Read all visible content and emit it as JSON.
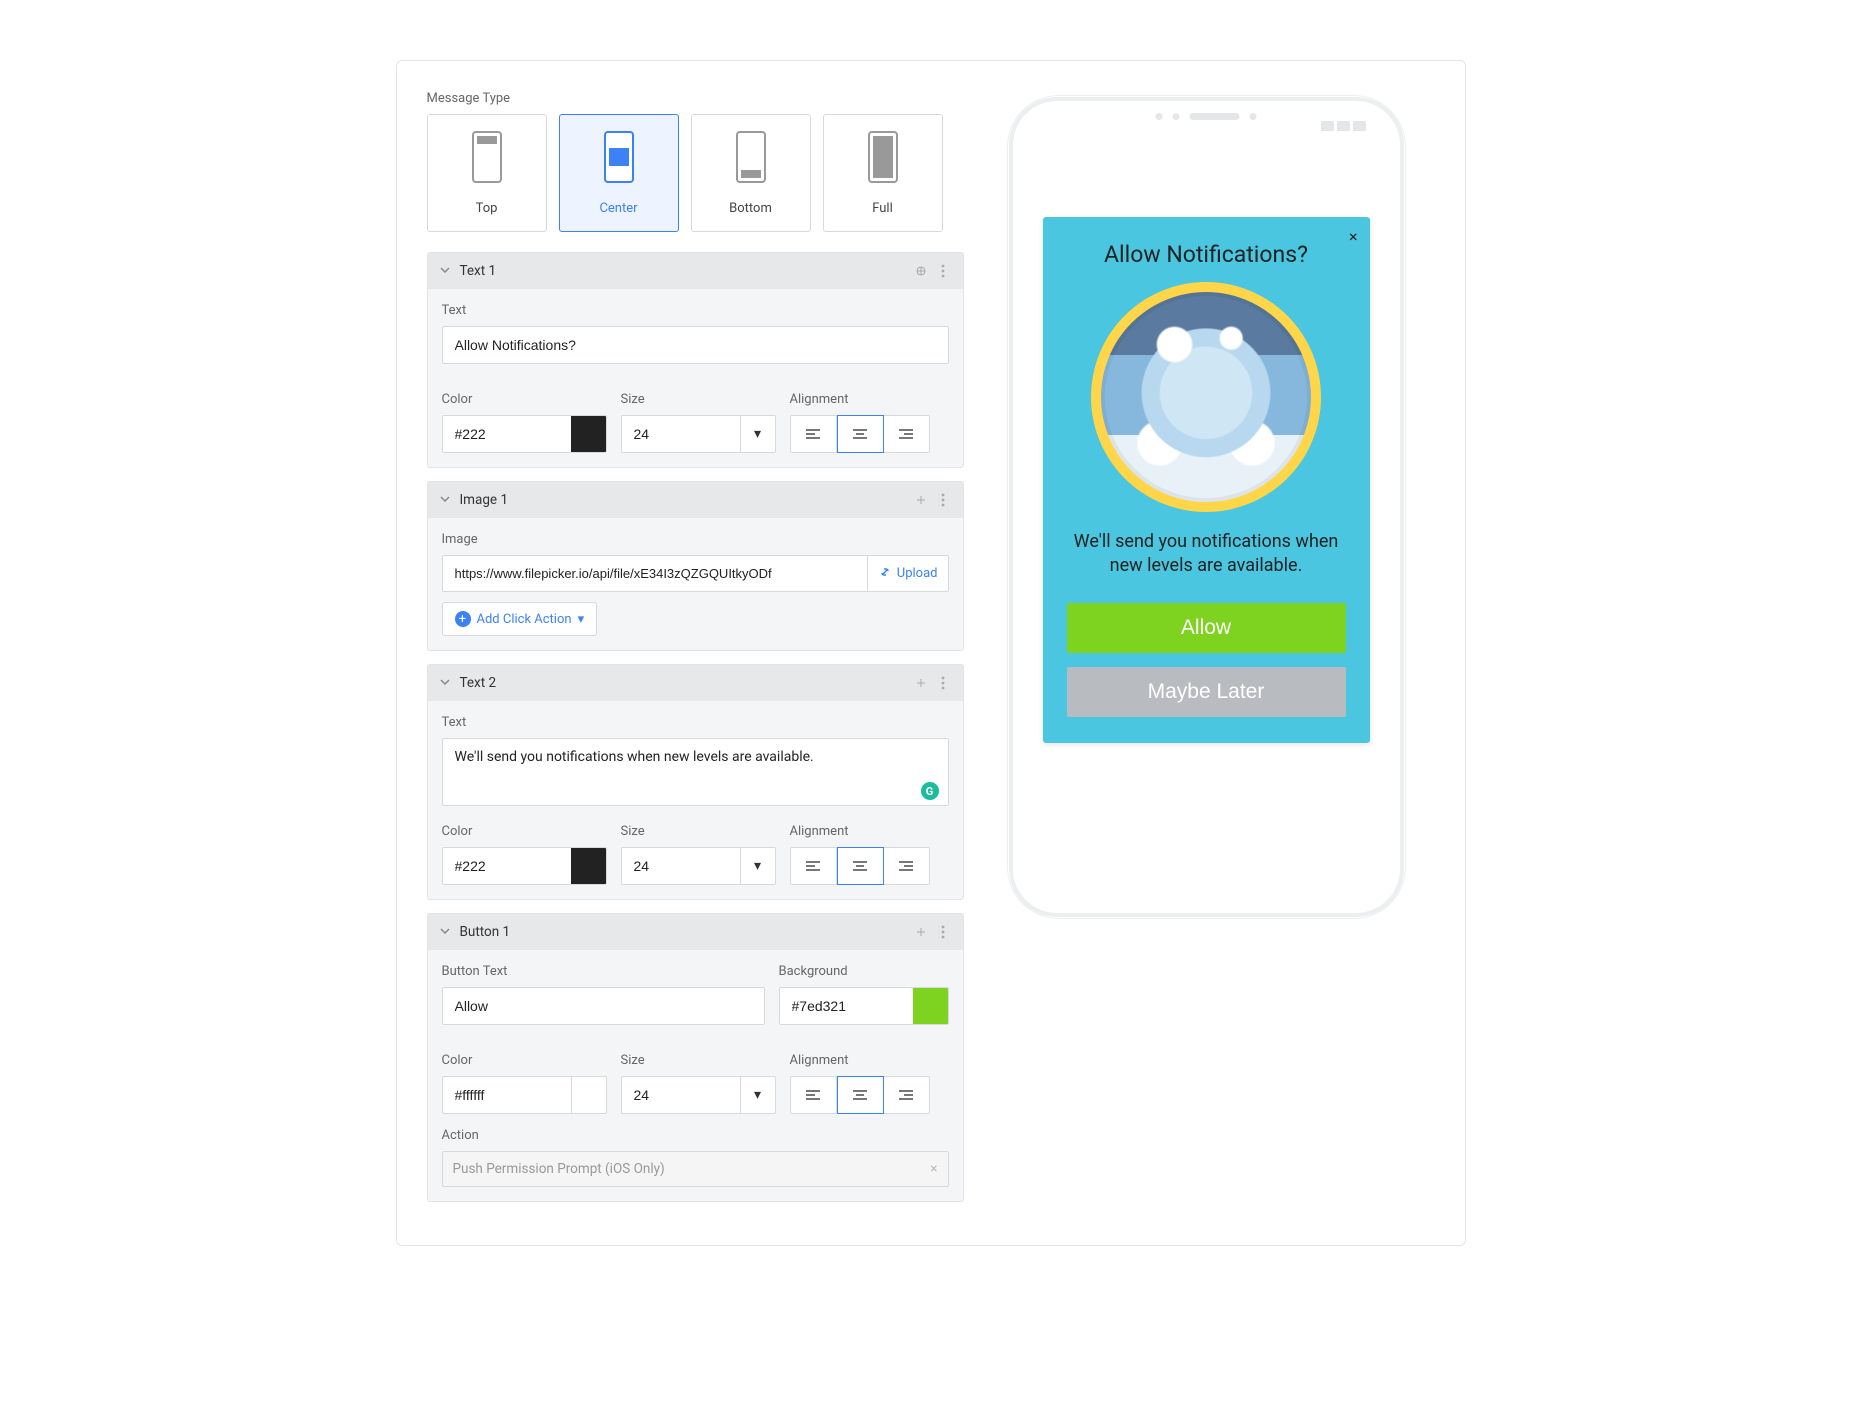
{
  "messageType": {
    "label": "Message Type",
    "options": [
      {
        "id": "top",
        "label": "Top"
      },
      {
        "id": "center",
        "label": "Center"
      },
      {
        "id": "bottom",
        "label": "Bottom"
      },
      {
        "id": "full",
        "label": "Full"
      }
    ],
    "selected": "center"
  },
  "sections": {
    "text1": {
      "title": "Text 1",
      "textLabel": "Text",
      "textValue": "Allow Notifications?",
      "colorLabel": "Color",
      "colorValue": "#222",
      "sizeLabel": "Size",
      "sizeValue": "24",
      "alignLabel": "Alignment",
      "alignSelected": "center"
    },
    "image1": {
      "title": "Image 1",
      "imageLabel": "Image",
      "imageValue": "https://www.filepicker.io/api/file/xE34I3zQZGQUItkyODf",
      "uploadLabel": "Upload",
      "addClickAction": "Add Click Action"
    },
    "text2": {
      "title": "Text 2",
      "textLabel": "Text",
      "textValue": "We'll send you notifications when new levels are available.",
      "colorLabel": "Color",
      "colorValue": "#222",
      "sizeLabel": "Size",
      "sizeValue": "24",
      "alignLabel": "Alignment",
      "alignSelected": "center"
    },
    "button1": {
      "title": "Button 1",
      "buttonTextLabel": "Button Text",
      "buttonTextValue": "Allow",
      "backgroundLabel": "Background",
      "backgroundValue": "#7ed321",
      "colorLabel": "Color",
      "colorValue": "#ffffff",
      "sizeLabel": "Size",
      "sizeValue": "24",
      "alignLabel": "Alignment",
      "alignSelected": "center",
      "actionLabel": "Action",
      "actionValue": "Push Permission Prompt (iOS Only)"
    }
  },
  "preview": {
    "title": "Allow Notifications?",
    "body": "We'll send you notifications when new levels are available.",
    "allowLabel": "Allow",
    "laterLabel": "Maybe Later"
  },
  "colors": {
    "text1Swatch": "#222222",
    "text2Swatch": "#222222",
    "button1ColorSwatch": "#ffffff",
    "button1BgSwatch": "#7ed321"
  }
}
